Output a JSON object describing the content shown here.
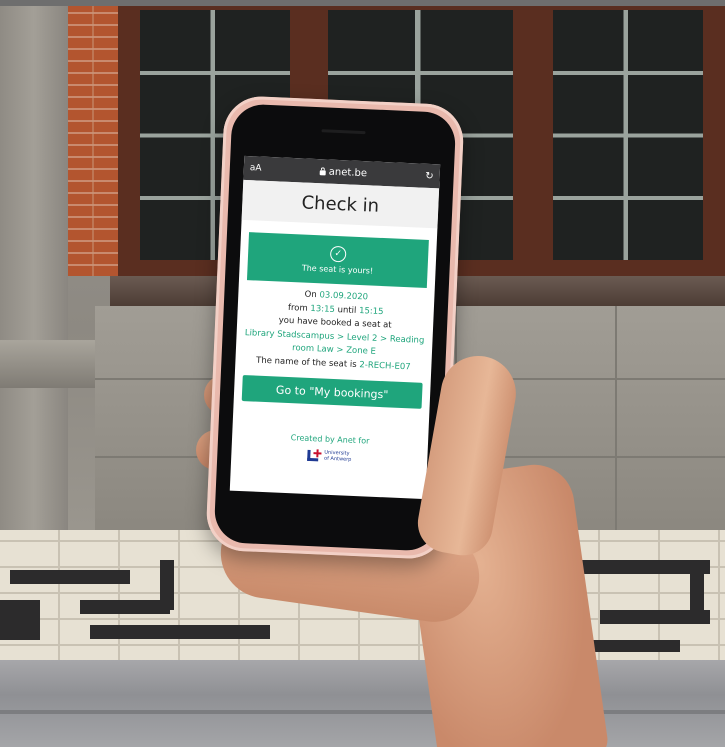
{
  "browser": {
    "text_size_label": "aA",
    "url": "anet.be",
    "reload_icon": "reload-icon"
  },
  "page": {
    "title": "Check in",
    "success_message": "The seat is yours!",
    "details": {
      "on_label": "On",
      "date": "03.09.2020",
      "from_label": "from",
      "start_time": "13:15",
      "until_label": "until",
      "end_time": "15:15",
      "booked_text": "you have booked a seat at",
      "location": "Library Stadscampus > Level 2 > Reading room Law > Zone E",
      "seat_name_label": "The name of the seat is",
      "seat_name": "2-RECH-E07"
    },
    "cta_label": "Go to \"My bookings\"",
    "footer_text": "Created by Anet for",
    "university_line1": "University",
    "university_line2": "of Antwerp"
  },
  "colors": {
    "accent": "#1fa57c",
    "url_bar": "#3a3a3c",
    "phone_case": "#e9b9ad"
  }
}
